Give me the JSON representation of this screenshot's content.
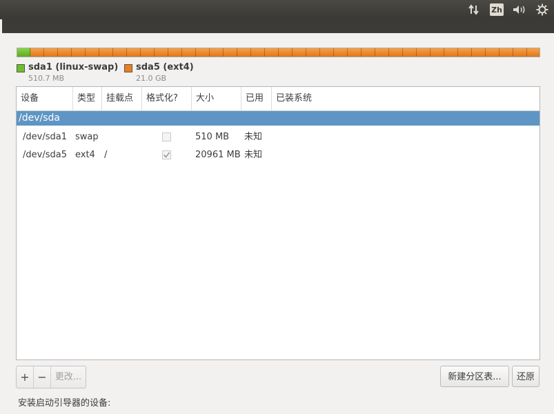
{
  "top_panel": {
    "ime_label": "Zh",
    "icons": [
      "network-icon",
      "volume-icon",
      "gear-icon"
    ]
  },
  "legend": [
    {
      "name": "sda1 (linux-swap)",
      "size": "510.7 MB",
      "color": "#6cc02a"
    },
    {
      "name": "sda5 (ext4)",
      "size": "21.0 GB",
      "color": "#e9801f"
    }
  ],
  "table": {
    "columns": [
      "设备",
      "类型",
      "挂载点",
      "格式化?",
      "大小",
      "已用",
      "已装系统"
    ],
    "disk_row": {
      "device": "/dev/sda"
    },
    "rows": [
      {
        "device": "/dev/sda1",
        "type": "swap",
        "mount": "",
        "format": false,
        "size": "510 MB",
        "used": "未知",
        "system": ""
      },
      {
        "device": "/dev/sda5",
        "type": "ext4",
        "mount": "/",
        "format": true,
        "size": "20961 MB",
        "used": "未知",
        "system": ""
      }
    ]
  },
  "toolbar": {
    "add_label": "+",
    "remove_label": "−",
    "change_label": "更改...",
    "new_table_label": "新建分区表...",
    "revert_label": "还原"
  },
  "bootloader_label": "安装启动引导器的设备:"
}
